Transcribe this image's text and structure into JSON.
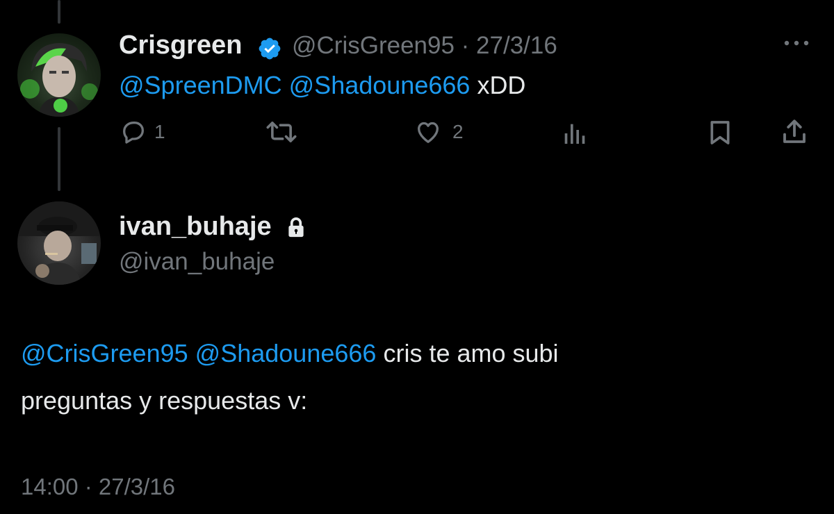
{
  "reply_tweet": {
    "display_name": "Crisgreen",
    "handle_date": "@CrisGreen95 · 27/3/16",
    "mention_1": "@SpreenDMC",
    "mention_2": "@Shadoune666",
    "text": "xDD",
    "replies": "1",
    "likes": "2"
  },
  "main_tweet": {
    "display_name": "ivan_buhaje",
    "handle": "@ivan_buhaje",
    "mention_1": "@CrisGreen95",
    "mention_2": "@Shadoune666",
    "text_line1": "cris te amo subi",
    "text_line2": "preguntas y respuestas v:",
    "timestamp": "14:00 · 27/3/16"
  },
  "colors": {
    "background": "#000000",
    "text": "#e7e9ea",
    "secondary": "#71767b",
    "link": "#1d9bf0",
    "verified": "#1d9bf0"
  },
  "icons": [
    "more-icon",
    "verified-icon",
    "reply-icon",
    "retweet-icon",
    "like-icon",
    "views-icon",
    "bookmark-icon",
    "share-icon",
    "lock-icon"
  ]
}
